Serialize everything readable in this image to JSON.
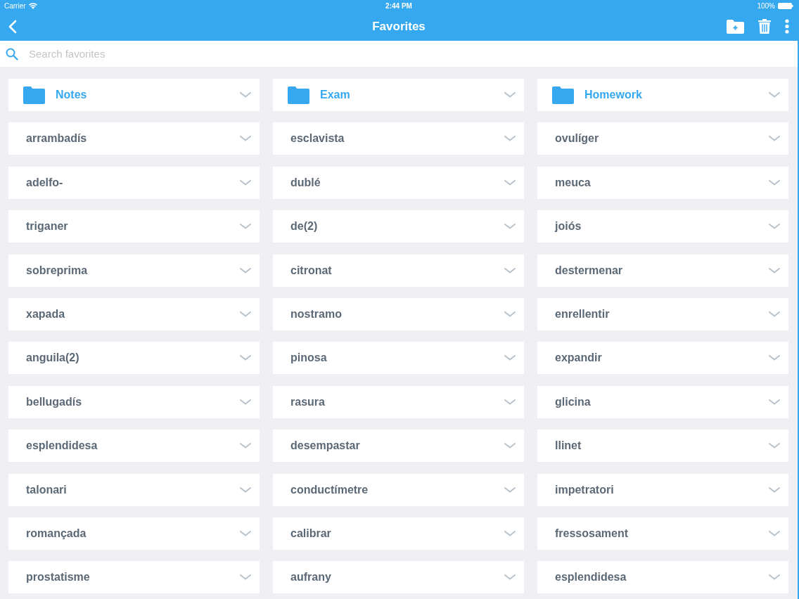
{
  "status_bar": {
    "carrier": "Carrier",
    "time": "2:44 PM",
    "battery": "100%"
  },
  "nav": {
    "title": "Favorites"
  },
  "search": {
    "placeholder": "Search favorites"
  },
  "items": [
    {
      "kind": "folder",
      "label": "Notes"
    },
    {
      "kind": "folder",
      "label": "Exam"
    },
    {
      "kind": "folder",
      "label": "Homework"
    },
    {
      "kind": "word",
      "label": "arrambadís"
    },
    {
      "kind": "word",
      "label": "esclavista"
    },
    {
      "kind": "word",
      "label": "ovulíger"
    },
    {
      "kind": "word",
      "label": "adelfo-"
    },
    {
      "kind": "word",
      "label": "dublé"
    },
    {
      "kind": "word",
      "label": "meuca"
    },
    {
      "kind": "word",
      "label": "triganer"
    },
    {
      "kind": "word",
      "label": "de(2)"
    },
    {
      "kind": "word",
      "label": "joiós"
    },
    {
      "kind": "word",
      "label": "sobreprima"
    },
    {
      "kind": "word",
      "label": "citronat"
    },
    {
      "kind": "word",
      "label": "destermenar"
    },
    {
      "kind": "word",
      "label": "xapada"
    },
    {
      "kind": "word",
      "label": "nostramo"
    },
    {
      "kind": "word",
      "label": "enrellentir"
    },
    {
      "kind": "word",
      "label": "anguila(2)"
    },
    {
      "kind": "word",
      "label": "pinosa"
    },
    {
      "kind": "word",
      "label": "expandir"
    },
    {
      "kind": "word",
      "label": "bellugadís"
    },
    {
      "kind": "word",
      "label": "rasura"
    },
    {
      "kind": "word",
      "label": "glicina"
    },
    {
      "kind": "word",
      "label": "esplendidesa"
    },
    {
      "kind": "word",
      "label": "desempastar"
    },
    {
      "kind": "word",
      "label": "llinet"
    },
    {
      "kind": "word",
      "label": "talonari"
    },
    {
      "kind": "word",
      "label": "conductímetre"
    },
    {
      "kind": "word",
      "label": "impetratori"
    },
    {
      "kind": "word",
      "label": "romançada"
    },
    {
      "kind": "word",
      "label": "calibrar"
    },
    {
      "kind": "word",
      "label": "fressosament"
    },
    {
      "kind": "word",
      "label": "prostatisme"
    },
    {
      "kind": "word",
      "label": "aufrany"
    },
    {
      "kind": "word",
      "label": "esplendidesa"
    }
  ]
}
